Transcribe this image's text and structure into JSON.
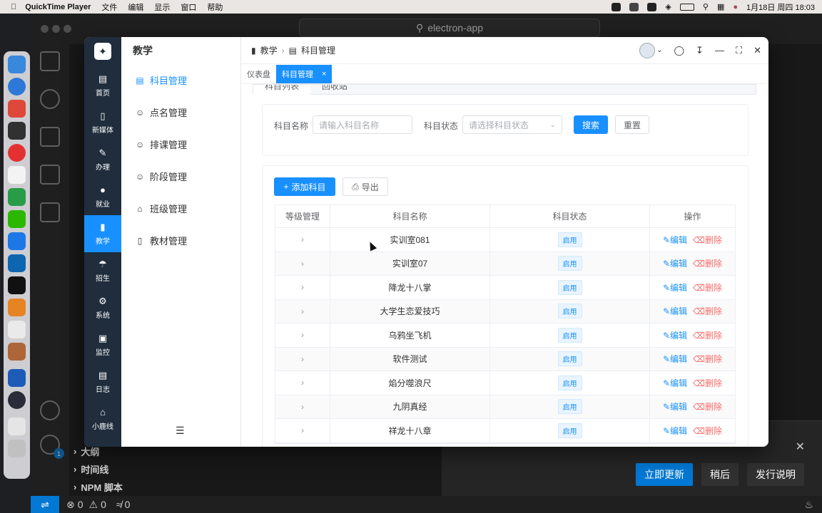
{
  "menubar": {
    "app_name": "QuickTime Player",
    "items": [
      "文件",
      "编辑",
      "显示",
      "窗口",
      "帮助"
    ],
    "clock": "1月18日 周四  18:03"
  },
  "vscode": {
    "search_text": "electron-app",
    "outline": [
      "大纲",
      "时间线",
      "NPM 脚本"
    ],
    "notification_buttons": [
      "立即更新",
      "稍后",
      "发行说明"
    ],
    "status": {
      "errors": "0",
      "warnings": "0",
      "ports": "0"
    },
    "settings_badge": "1"
  },
  "app": {
    "rail": [
      {
        "label": "首页",
        "icon": "home-doc-icon"
      },
      {
        "label": "新媒体",
        "icon": "tablet-icon"
      },
      {
        "label": "办理",
        "icon": "pen-icon"
      },
      {
        "label": "就业",
        "icon": "user-icon"
      },
      {
        "label": "教学",
        "icon": "book-icon",
        "active": true
      },
      {
        "label": "招生",
        "icon": "headset-icon"
      },
      {
        "label": "系统",
        "icon": "gear-icon"
      },
      {
        "label": "监控",
        "icon": "monitor-icon"
      },
      {
        "label": "日志",
        "icon": "log-icon"
      },
      {
        "label": "小鹿线",
        "icon": "house-icon"
      }
    ],
    "menu_title": "教学",
    "menu": [
      {
        "label": "科目管理",
        "active": true
      },
      {
        "label": "点名管理"
      },
      {
        "label": "排课管理"
      },
      {
        "label": "阶段管理"
      },
      {
        "label": "班级管理"
      },
      {
        "label": "教材管理"
      }
    ],
    "breadcrumb": [
      "教学",
      "科目管理"
    ],
    "tabs": [
      {
        "label": "仪表盘"
      },
      {
        "label": "科目管理",
        "active": true
      }
    ],
    "subtabs": [
      "科目列表",
      "回收站"
    ],
    "filter": {
      "name_label": "科目名称",
      "name_placeholder": "请输入科目名称",
      "status_label": "科目状态",
      "status_placeholder": "请选择科目状态",
      "search_btn": "搜索",
      "reset_btn": "重置"
    },
    "actions": {
      "add": "添加科目",
      "export": "导出"
    },
    "table": {
      "headers": [
        "等级管理",
        "科目名称",
        "科目状态",
        "操作"
      ],
      "edit_label": "编辑",
      "delete_label": "删除",
      "rows": [
        {
          "name": "实训室081",
          "status": "启用"
        },
        {
          "name": "实训室07",
          "status": "启用"
        },
        {
          "name": "降龙十八掌",
          "status": "启用"
        },
        {
          "name": "大学生恋爱技巧",
          "status": "启用"
        },
        {
          "name": "乌鸦坐飞机",
          "status": "启用"
        },
        {
          "name": "软件测试",
          "status": "启用"
        },
        {
          "name": "焰分噬浪尺",
          "status": "启用"
        },
        {
          "name": "九阴真经",
          "status": "启用"
        },
        {
          "name": "祥龙十八章",
          "status": "启用"
        }
      ]
    }
  }
}
